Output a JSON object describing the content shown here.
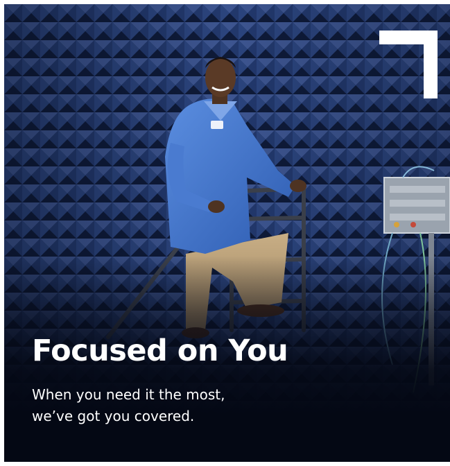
{
  "hero": {
    "headline": "Focused on You",
    "subline": [
      "When you need it the most,",
      "we’ve got you covered."
    ],
    "corner_mark": "bracket-logo-mark"
  },
  "colors": {
    "background": "#0a1021",
    "chamber_wall": "#1d2f5c",
    "lab_coat": "#3b6fc9",
    "text": "#ffffff"
  }
}
